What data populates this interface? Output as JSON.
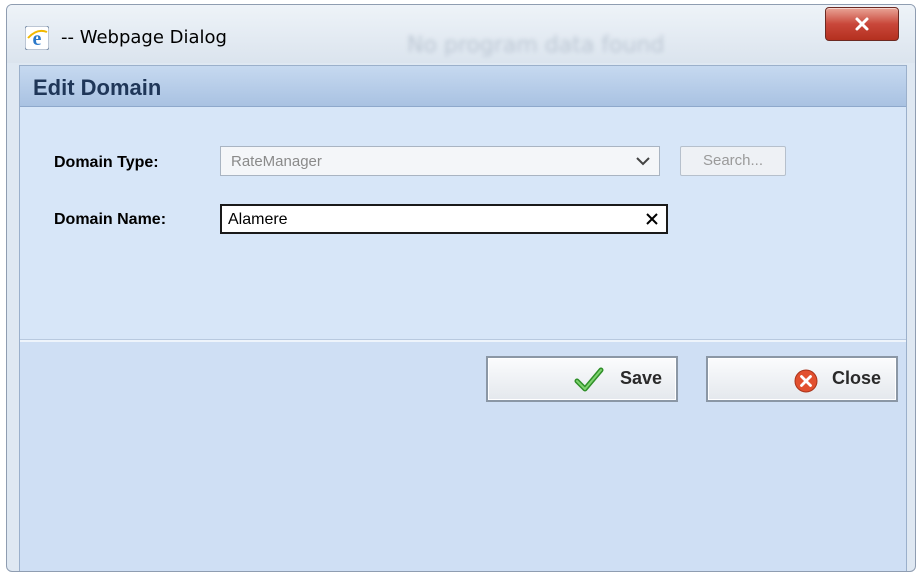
{
  "window": {
    "title": "-- Webpage Dialog",
    "background_text": "No program data found"
  },
  "dialog": {
    "header_title": "Edit Domain"
  },
  "form": {
    "domain_type_label": "Domain Type:",
    "domain_type_value": "RateManager",
    "search_label": "Search...",
    "domain_name_label": "Domain Name:",
    "domain_name_value": "Alamere"
  },
  "buttons": {
    "save_label": "Save",
    "close_label": "Close"
  },
  "colors": {
    "header_text": "#1f3658",
    "panel_bg": "#cfdff4",
    "close_red": "#c9473a",
    "save_green": "#3fa535"
  }
}
